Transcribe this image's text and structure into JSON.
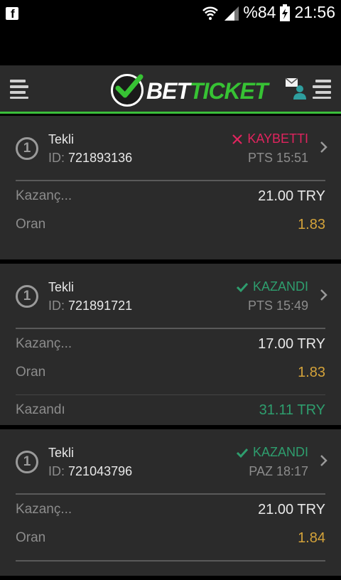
{
  "status_bar": {
    "battery": "%84",
    "time": "21:56"
  },
  "header": {
    "logo_bet": "BET",
    "logo_ticket": "TICKET"
  },
  "tickets": [
    {
      "number": "1",
      "type": "Tekli",
      "id_label": "ID:",
      "id": "721893136",
      "status": "KAYBETTI",
      "status_kind": "lost",
      "date": "PTS 15:51",
      "stake_label": "Kazanç...",
      "stake": "21.00 TRY",
      "odds_label": "Oran",
      "odds": "1.83"
    },
    {
      "number": "1",
      "type": "Tekli",
      "id_label": "ID:",
      "id": "721891721",
      "status": "KAZANDI",
      "status_kind": "won",
      "date": "PTS 15:49",
      "stake_label": "Kazanç...",
      "stake": "17.00 TRY",
      "odds_label": "Oran",
      "odds": "1.83",
      "win_label": "Kazandı",
      "win": "31.11 TRY"
    },
    {
      "number": "1",
      "type": "Tekli",
      "id_label": "ID:",
      "id": "721043796",
      "status": "KAZANDI",
      "status_kind": "won",
      "date": "PAZ 18:17",
      "stake_label": "Kazanç...",
      "stake": "21.00 TRY",
      "odds_label": "Oran",
      "odds": "1.84"
    }
  ],
  "colors": {
    "accent_green": "#37c234",
    "lost_red": "#e0245e",
    "won_green": "#2e9e6e",
    "odds_gold": "#d4a33a"
  },
  "icons": [
    "facebook-icon",
    "wifi-icon",
    "signal-icon",
    "battery-icon",
    "menu-icon",
    "logo-check-icon",
    "user-messages-icon",
    "close-x-icon",
    "check-icon",
    "chevron-right-icon"
  ]
}
